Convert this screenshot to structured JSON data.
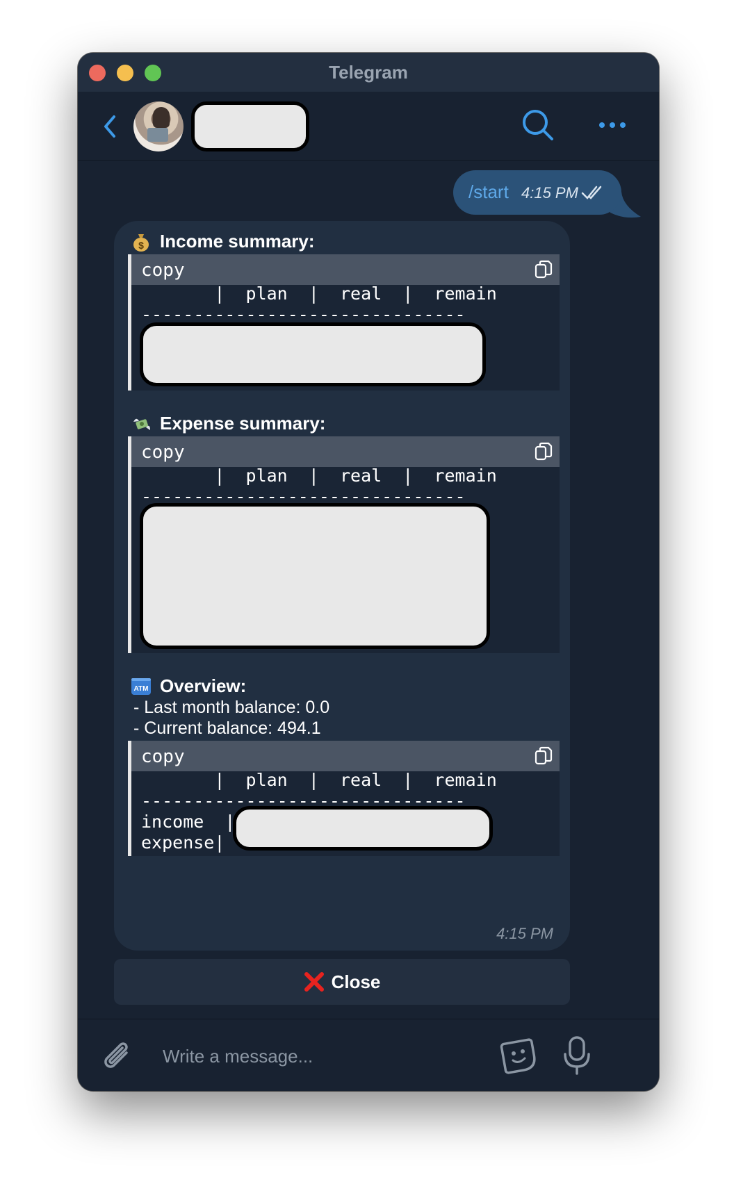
{
  "window": {
    "title": "Telegram"
  },
  "header": {
    "contact_name": "",
    "back_icon": "chevron-left-icon",
    "search_icon": "search-icon",
    "more_icon": "more-dots-icon"
  },
  "outgoing_message": {
    "text": "/start",
    "time": "4:15 PM",
    "status": "read"
  },
  "incoming_message": {
    "time": "4:15 PM",
    "income": {
      "title": "Income summary:",
      "emoji": "money-bag-icon",
      "code": {
        "lang": "copy",
        "header_row": "       |  plan  |  real  |  remain",
        "rule": "-------------------------------"
      }
    },
    "expense": {
      "title": "Expense summary:",
      "emoji": "money-wings-icon",
      "code": {
        "lang": "copy",
        "header_row": "       |  plan  |  real  |  remain",
        "rule": "-------------------------------"
      }
    },
    "overview": {
      "title": "Overview:",
      "emoji": "atm-icon",
      "lines": [
        "- Last month balance: 0.0",
        "- Current balance: 494.1"
      ],
      "code": {
        "lang": "copy",
        "header_row": "       |  plan  |  real  |  remain",
        "rule": "-------------------------------",
        "rows": [
          "income  |",
          "expense|"
        ]
      }
    }
  },
  "inline_button": {
    "label": "Close",
    "icon": "cross-mark-icon"
  },
  "composer": {
    "placeholder": "Write a message..."
  },
  "colors": {
    "accent": "#3d9ae8",
    "window_bg": "#182231",
    "bubble_in": "#212f41",
    "bubble_out": "#2b5278"
  }
}
